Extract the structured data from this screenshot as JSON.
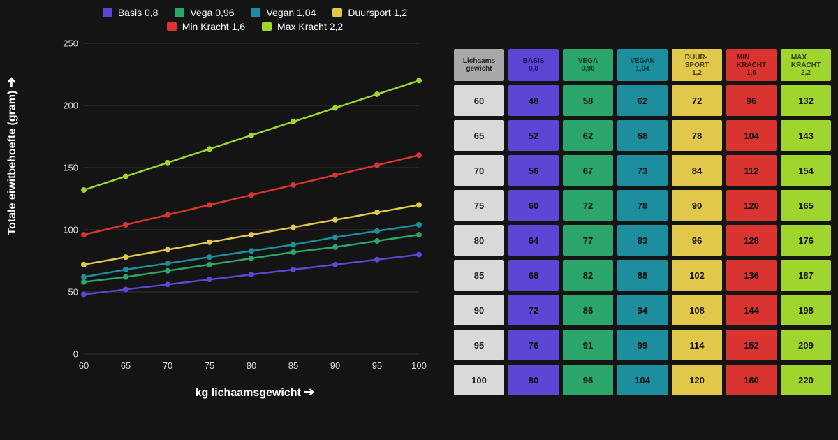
{
  "chart_data": {
    "type": "line",
    "x": [
      60,
      65,
      70,
      75,
      80,
      85,
      90,
      95,
      100
    ],
    "series": [
      {
        "name": "Basis 0,8",
        "color": "#5b46d6",
        "key": "basis",
        "values": [
          48,
          52,
          56,
          60,
          64,
          68,
          72,
          76,
          80
        ]
      },
      {
        "name": "Vega 0,96",
        "color": "#2ca56a",
        "key": "vega",
        "values": [
          58,
          62,
          67,
          72,
          77,
          82,
          86,
          91,
          96
        ]
      },
      {
        "name": "Vegan 1,04",
        "color": "#1c8e9e",
        "key": "vegan",
        "values": [
          62,
          68,
          73,
          78,
          83,
          88,
          94,
          99,
          104
        ]
      },
      {
        "name": "Duursport 1,2",
        "color": "#e2c84a",
        "key": "duur",
        "values": [
          72,
          78,
          84,
          90,
          96,
          102,
          108,
          114,
          120
        ]
      },
      {
        "name": "Min Kracht 1,6",
        "color": "#d9342f",
        "key": "min",
        "values": [
          96,
          104,
          112,
          120,
          128,
          136,
          144,
          152,
          160
        ]
      },
      {
        "name": "Max Kracht 2,2",
        "color": "#a0d52e",
        "key": "max",
        "values": [
          132,
          143,
          154,
          165,
          176,
          187,
          198,
          209,
          220
        ]
      }
    ],
    "ylim": [
      0,
      250
    ],
    "yticks": [
      0,
      50,
      100,
      150,
      200,
      250
    ],
    "xlabel": "kg lichaamsgewicht",
    "ylabel": "Totale eiwitbehoefte (gram)"
  },
  "legend_rows": [
    [
      "Basis 0,8",
      "Vega 0,96",
      "Vegan 1,04",
      "Duursport 1,2"
    ],
    [
      "Min Kracht 1,6",
      "Max Kracht 2,2"
    ]
  ],
  "table": {
    "headers": [
      {
        "line1": "Lichaams",
        "line2": "gewicht",
        "class": "c-weight-h"
      },
      {
        "line1": "BASIS",
        "line2": "0,8",
        "class": "c-basis"
      },
      {
        "line1": "VEGA",
        "line2": "0,96",
        "class": "c-vega"
      },
      {
        "line1": "VEGAN",
        "line2": "1,04",
        "class": "c-vegan"
      },
      {
        "line1": "DUUR-\nSPORT",
        "line2": "1,2",
        "class": "c-duur"
      },
      {
        "line1": "MIN\nKRACHT",
        "line2": "1,6",
        "class": "c-min"
      },
      {
        "line1": "MAX\nKRACHT",
        "line2": "2,2",
        "class": "c-max"
      }
    ],
    "weights": [
      60,
      65,
      70,
      75,
      80,
      85,
      90,
      95,
      100
    ]
  }
}
